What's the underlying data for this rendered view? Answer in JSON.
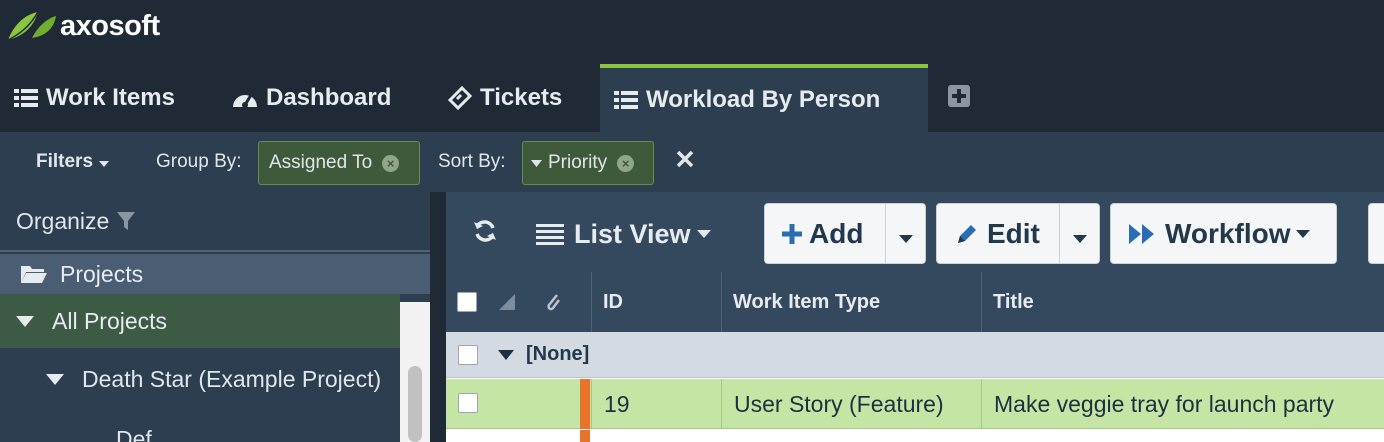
{
  "app": {
    "logo_text": "axosoft"
  },
  "tabs": [
    {
      "label": "Work Items",
      "icon": "list-icon",
      "active": false
    },
    {
      "label": "Dashboard",
      "icon": "dashboard-icon",
      "active": false
    },
    {
      "label": "Tickets",
      "icon": "ticket-icon",
      "active": false
    },
    {
      "label": "Workload By Person",
      "icon": "list-icon",
      "active": true
    }
  ],
  "filterbar": {
    "filters_label": "Filters",
    "group_by_label": "Group By:",
    "group_by_value": "Assigned To",
    "sort_by_label": "Sort By:",
    "sort_by_value": "Priority"
  },
  "sidebar": {
    "organize_label": "Organize",
    "projects_label": "Projects",
    "all_projects_label": "All Projects",
    "death_star_label": "Death Star (Example Project)",
    "child_label": "Def"
  },
  "toolbar": {
    "view_label": "List View",
    "add_label": "Add",
    "edit_label": "Edit",
    "workflow_label": "Workflow"
  },
  "grid": {
    "columns": [
      "ID",
      "Work Item Type",
      "Title"
    ],
    "group_label": "[None]",
    "rows": [
      {
        "id": "19",
        "type": "User Story (Feature)",
        "title": "Make veggie tray for launch party",
        "priority_color": "#e8742a"
      }
    ]
  },
  "colors": {
    "accent": "#8cc63f",
    "priority_high": "#e8742a",
    "row_selected": "#c5e5a5"
  }
}
